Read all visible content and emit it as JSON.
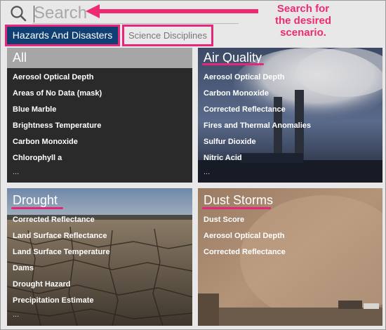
{
  "search": {
    "placeholder": "Search"
  },
  "annotation": {
    "text": "Search for\nthe desired\nscenario.",
    "color": "#ee2a73"
  },
  "tabs": [
    {
      "label": "Hazards And Disasters",
      "active": true
    },
    {
      "label": "Science Disciplines",
      "active": false
    }
  ],
  "cards": {
    "all": {
      "title": "All",
      "items": [
        "Aerosol Optical Depth",
        "Areas of No Data (mask)",
        "Blue Marble",
        "Brightness Temperature",
        "Carbon Monoxide",
        "Chlorophyll a"
      ],
      "more": "..."
    },
    "air_quality": {
      "title": "Air Quality",
      "items": [
        "Aerosol Optical Depth",
        "Carbon Monoxide",
        "Corrected Reflectance",
        "Fires and Thermal Anomalies",
        "Sulfur Dioxide",
        "Nitric Acid"
      ],
      "more": "..."
    },
    "drought": {
      "title": "Drought",
      "items": [
        "Corrected Reflectance",
        "Land Surface Reflectance",
        "Land Surface Temperature",
        "Dams",
        "Drought Hazard",
        "Precipitation Estimate"
      ],
      "more": "..."
    },
    "dust_storms": {
      "title": "Dust Storms",
      "items": [
        "Dust Score",
        "Aerosol Optical Depth",
        "Corrected Reflectance"
      ]
    }
  },
  "colors": {
    "accent": "#e4277a",
    "tab_active_bg": "#0f3f73"
  },
  "icons": [
    "search-icon"
  ]
}
